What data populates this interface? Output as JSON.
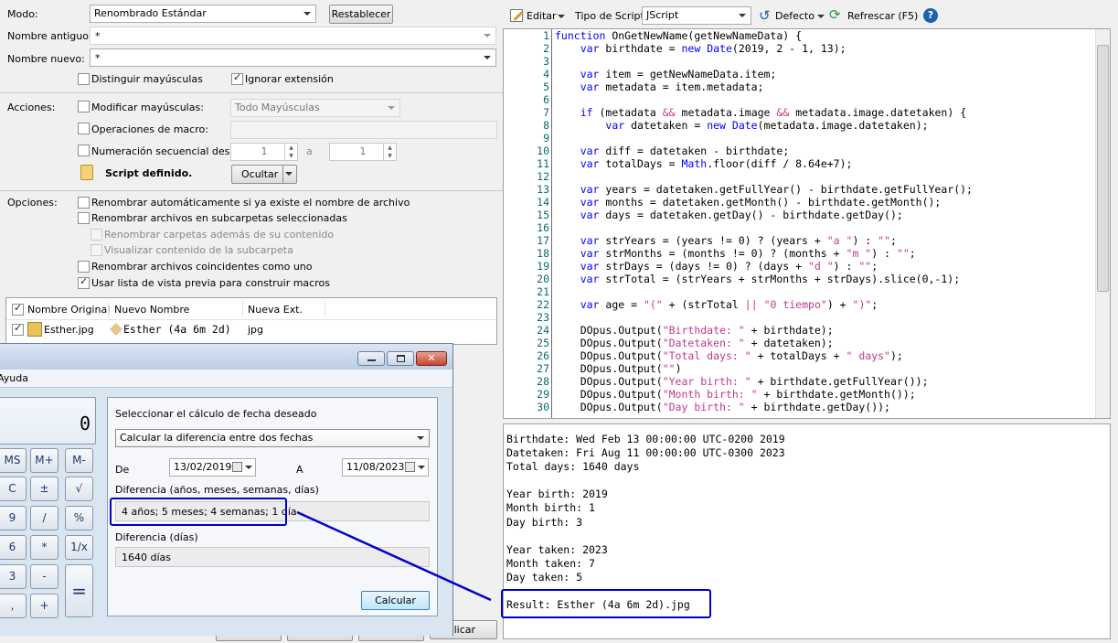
{
  "left": {
    "mode_label": "Modo:",
    "mode_value": "Renombrado Estándar",
    "reset_button": "Restablecer",
    "old_name_label": "Nombre antiguo:",
    "old_name_value": "*",
    "new_name_label": "Nombre nuevo:",
    "new_name_value": "*",
    "case_sensitive": "Distinguir mayúsculas",
    "ignore_ext": "Ignorar extensión",
    "actions_label": "Acciones:",
    "modify_case": "Modificar mayúsculas:",
    "case_value": "Todo Mayúsculas",
    "macro_ops": "Operaciones de macro:",
    "seq_numbering": "Numeración secuencial desde",
    "seq_from": "1",
    "seq_to_label": "a",
    "seq_to": "1",
    "script_defined": "Script definido.",
    "hide_button": "Ocultar",
    "options_label": "Opciones:",
    "opt1": "Renombrar automáticamente si ya existe el nombre de archivo",
    "opt2": "Renombrar archivos en subcarpetas seleccionadas",
    "opt3": "Renombrar carpetas además de su contenido",
    "opt4": "Visualizar contenido de la subcarpeta",
    "opt5": "Renombrar archivos coincidentes como uno",
    "opt6": "Usar lista de vista previa para construir macros",
    "col_original": "Nombre Original",
    "col_new": "Nuevo Nombre",
    "col_ext": "Nueva Ext.",
    "row_original": "Esther.jpg",
    "row_new": "Esther (4a 6m 2d)",
    "row_ext": "jpg",
    "apply_fragment": "plicar"
  },
  "toolbar": {
    "edit": "Editar",
    "script_type_label": "Tipo de Script",
    "script_type": "JScript",
    "default": "Defecto",
    "refresh": "Refrescar (F5)"
  },
  "code_lines": [
    "function OnGetNewName(getNewNameData) {",
    "    var birthdate = new Date(2019, 2 - 1, 13);",
    "",
    "    var item = getNewNameData.item;",
    "    var metadata = item.metadata;",
    "",
    "    if (metadata && metadata.image && metadata.image.datetaken) {",
    "        var datetaken = new Date(metadata.image.datetaken);",
    "",
    "    var diff = datetaken - birthdate;",
    "    var totalDays = Math.floor(diff / 8.64e+7);",
    "",
    "    var years = datetaken.getFullYear() - birthdate.getFullYear();",
    "    var months = datetaken.getMonth() - birthdate.getMonth();",
    "    var days = datetaken.getDay() - birthdate.getDay();",
    "",
    "    var strYears = (years != 0) ? (years + \"a \") : \"\";",
    "    var strMonths = (months != 0) ? (months + \"m \") : \"\";",
    "    var strDays = (days != 0) ? (days + \"d \") : \"\";",
    "    var strTotal = (strYears + strMonths + strDays).slice(0,-1);",
    "",
    "    var age = \"(\" + (strTotal || \"0 tiempo\") + \")\";",
    "",
    "    DOpus.Output(\"Birthdate: \" + birthdate);",
    "    DOpus.Output(\"Datetaken: \" + datetaken);",
    "    DOpus.Output(\"Total days: \" + totalDays + \" days\");",
    "    DOpus.Output(\"\")",
    "    DOpus.Output(\"Year birth: \" + birthdate.getFullYear());",
    "    DOpus.Output(\"Month birth: \" + birthdate.getMonth());",
    "    DOpus.Output(\"Day birth: \" + birthdate.getDay());"
  ],
  "output_lines": [
    "Birthdate: Wed Feb 13 00:00:00 UTC-0200 2019",
    "Datetaken: Fri Aug 11 00:00:00 UTC-0300 2023",
    "Total days: 1640 days",
    "",
    "Year birth: 2019",
    "Month birth: 1",
    "Day birth: 3",
    "",
    "Year taken: 2023",
    "Month taken: 7",
    "Day taken: 5",
    "",
    "Result: Esther (4a 6m 2d).jpg"
  ],
  "calc": {
    "menu_help": "Ayuda",
    "display": "0",
    "keys": [
      "MS",
      "M+",
      "M-",
      "C",
      "±",
      "√",
      "9",
      "/",
      "%",
      "6",
      "*",
      "1/x",
      "3",
      "-",
      "=",
      ",",
      "+"
    ],
    "select_calc_label": "Seleccionar el cálculo de fecha deseado",
    "calc_mode": "Calcular la diferencia entre dos fechas",
    "from_label": "De",
    "from_date": "13/02/2019",
    "to_label": "A",
    "to_date": "11/08/2023",
    "diff_label": "Diferencia (años, meses, semanas, días)",
    "diff_value": "4 años; 5 meses; 4 semanas; 1 día",
    "diff_days_label": "Diferencia (días)",
    "diff_days_value": "1640 días",
    "calc_button": "Calcular"
  },
  "colors": {
    "highlight": "#0000cc",
    "keyword": "#0000ff",
    "string": "#c03a8e"
  }
}
